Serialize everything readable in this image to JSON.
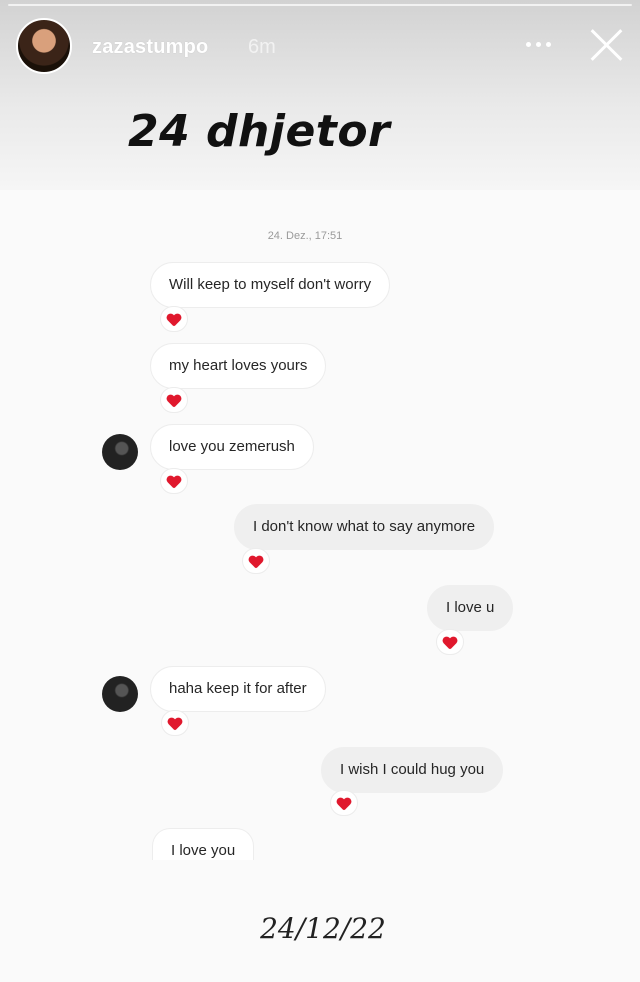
{
  "story": {
    "username": "zazastumpo",
    "time_ago": "6m",
    "title": "24 dhjetor",
    "footer_date": "24/12/22"
  },
  "chat": {
    "timestamp": "24. Dez., 17:51",
    "messages": [
      {
        "text": "Will keep to myself don't worry",
        "side": "left",
        "reaction": "heart-icon"
      },
      {
        "text": "my heart loves yours",
        "side": "left",
        "reaction": "heart-icon"
      },
      {
        "text": "love you zemerush",
        "side": "left",
        "reaction": "heart-icon"
      },
      {
        "text": "I don't know what to say anymore",
        "side": "right",
        "reaction": "heart-icon"
      },
      {
        "text": "I love u",
        "side": "right",
        "reaction": "heart-icon"
      },
      {
        "text": "haha keep it for after",
        "side": "left",
        "reaction": "heart-icon"
      },
      {
        "text": "I wish I could hug you",
        "side": "right",
        "reaction": "heart-icon"
      },
      {
        "text": "I love you",
        "side": "left"
      }
    ]
  },
  "colors": {
    "heart": "#e0182d",
    "sent_bubble": "#efefef",
    "received_bubble": "#ffffff"
  }
}
